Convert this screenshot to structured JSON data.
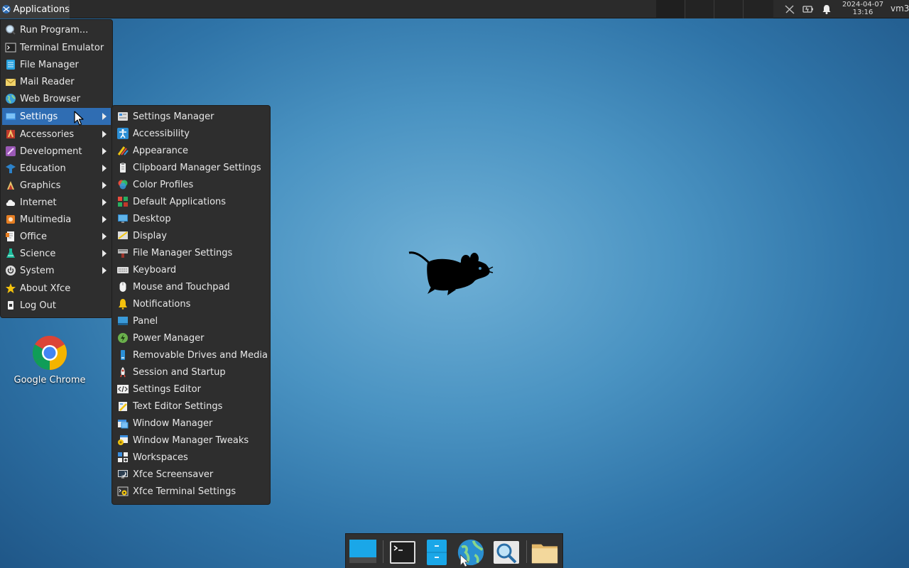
{
  "top_panel": {
    "applications_label": "Applications",
    "clock_date": "2024-04-07",
    "clock_time": "13:16",
    "hostname": "vm3",
    "tray_icons": [
      "network-disconnected-icon",
      "battery-icon",
      "notification-bell-icon"
    ]
  },
  "main_menu": {
    "items": [
      {
        "label": "Run Program...",
        "icon": "run-icon"
      },
      {
        "label": "Terminal Emulator",
        "icon": "terminal-icon"
      },
      {
        "label": "File Manager",
        "icon": "file-manager-icon"
      },
      {
        "label": "Mail Reader",
        "icon": "mail-icon"
      },
      {
        "label": "Web Browser",
        "icon": "globe-icon"
      },
      {
        "label": "Settings",
        "icon": "settings-icon",
        "submenu": true,
        "active": true
      },
      {
        "label": "Accessories",
        "icon": "accessories-icon",
        "submenu": true
      },
      {
        "label": "Development",
        "icon": "development-icon",
        "submenu": true
      },
      {
        "label": "Education",
        "icon": "education-icon",
        "submenu": true
      },
      {
        "label": "Graphics",
        "icon": "graphics-icon",
        "submenu": true
      },
      {
        "label": "Internet",
        "icon": "cloud-icon",
        "submenu": true
      },
      {
        "label": "Multimedia",
        "icon": "multimedia-icon",
        "submenu": true
      },
      {
        "label": "Office",
        "icon": "office-icon",
        "submenu": true
      },
      {
        "label": "Science",
        "icon": "science-icon",
        "submenu": true
      },
      {
        "label": "System",
        "icon": "power-icon",
        "submenu": true
      },
      {
        "label": "About Xfce",
        "icon": "star-icon"
      },
      {
        "label": "Log Out",
        "icon": "logout-icon"
      }
    ]
  },
  "settings_menu": {
    "items": [
      {
        "label": "Settings Manager"
      },
      {
        "label": "Accessibility"
      },
      {
        "label": "Appearance"
      },
      {
        "label": "Clipboard Manager Settings"
      },
      {
        "label": "Color Profiles"
      },
      {
        "label": "Default Applications"
      },
      {
        "label": "Desktop"
      },
      {
        "label": "Display"
      },
      {
        "label": "File Manager Settings"
      },
      {
        "label": "Keyboard"
      },
      {
        "label": "Mouse and Touchpad"
      },
      {
        "label": "Notifications"
      },
      {
        "label": "Panel"
      },
      {
        "label": "Power Manager"
      },
      {
        "label": "Removable Drives and Media"
      },
      {
        "label": "Session and Startup"
      },
      {
        "label": "Settings Editor"
      },
      {
        "label": "Text Editor Settings"
      },
      {
        "label": "Window Manager"
      },
      {
        "label": "Window Manager Tweaks"
      },
      {
        "label": "Workspaces"
      },
      {
        "label": "Xfce Screensaver"
      },
      {
        "label": "Xfce Terminal Settings"
      }
    ]
  },
  "desktop": {
    "icons": [
      {
        "label": "Google Chrome",
        "icon": "chrome-icon"
      }
    ]
  },
  "dock": {
    "items": [
      {
        "icon": "show-desktop-icon"
      },
      {
        "icon": "terminal-icon"
      },
      {
        "icon": "file-manager-icon"
      },
      {
        "icon": "web-browser-icon"
      },
      {
        "icon": "app-finder-icon"
      },
      {
        "icon": "folder-icon"
      }
    ]
  },
  "colors": {
    "panel_bg": "#2b2b2b",
    "menu_bg": "#2e2e2e",
    "selection": "#2f6db3",
    "desktop_center": "#6fb0d6",
    "desktop_edge": "#1f5687"
  }
}
